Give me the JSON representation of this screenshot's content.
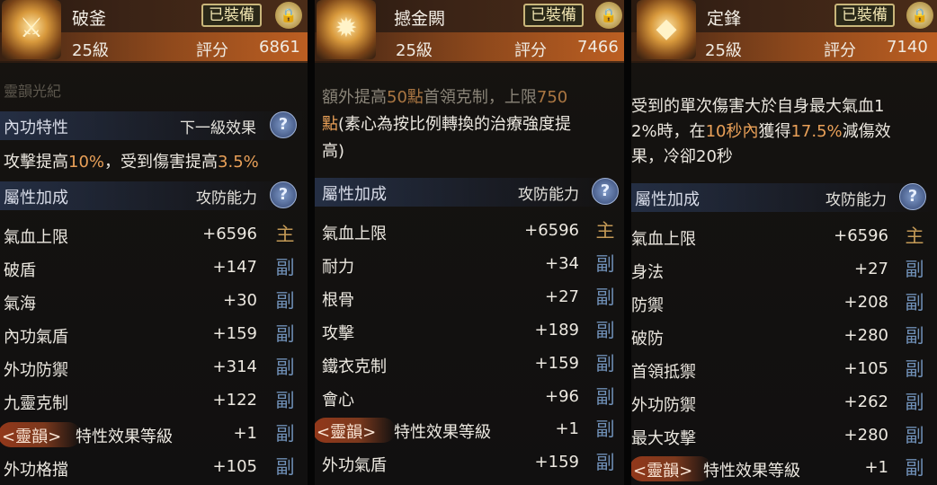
{
  "panels": [
    {
      "name": "破釜",
      "level": "25級",
      "equipped": "已裝備",
      "score_label": "評分",
      "score": "6861",
      "top_faded": "靈韻光紀",
      "trait": {
        "title": "內功特性",
        "right": "下一級效果",
        "text_parts": [
          "攻擊提高",
          "10%",
          "，受到傷害提高",
          "3.5%"
        ]
      },
      "attr": {
        "title": "屬性加成",
        "right": "攻防能力"
      },
      "stats": [
        {
          "name": "氣血上限",
          "value": "+6596",
          "tag": "主",
          "kind": "main"
        },
        {
          "name": "破盾",
          "value": "+147",
          "tag": "副",
          "kind": "sub"
        },
        {
          "name": "氣海",
          "value": "+30",
          "tag": "副",
          "kind": "sub"
        },
        {
          "name": "內功氣盾",
          "value": "+159",
          "tag": "副",
          "kind": "sub"
        },
        {
          "name": "外功防禦",
          "value": "+314",
          "tag": "副",
          "kind": "sub"
        },
        {
          "name": "九靈克制",
          "value": "+122",
          "tag": "副",
          "kind": "sub"
        }
      ],
      "rune": {
        "label": "<靈韻>",
        "name": "特性效果等級",
        "value": "+1",
        "tag": "副"
      },
      "last": {
        "name": "外功格擋",
        "value": "+105",
        "tag": "副"
      }
    },
    {
      "name": "撼金闕",
      "level": "25級",
      "equipped": "已裝備",
      "score_label": "評分",
      "score": "7466",
      "trait_lines": [
        [
          "額外提高",
          "50點",
          "首領克制，上限",
          "750"
        ],
        [
          "點",
          "(素心為按比例轉換的治療強度提"
        ],
        [
          "高)"
        ]
      ],
      "attr": {
        "title": "屬性加成",
        "right": "攻防能力"
      },
      "stats": [
        {
          "name": "氣血上限",
          "value": "+6596",
          "tag": "主",
          "kind": "main"
        },
        {
          "name": "耐力",
          "value": "+34",
          "tag": "副",
          "kind": "sub"
        },
        {
          "name": "根骨",
          "value": "+27",
          "tag": "副",
          "kind": "sub"
        },
        {
          "name": "攻擊",
          "value": "+189",
          "tag": "副",
          "kind": "sub"
        },
        {
          "name": "鐵衣克制",
          "value": "+159",
          "tag": "副",
          "kind": "sub"
        },
        {
          "name": "會心",
          "value": "+96",
          "tag": "副",
          "kind": "sub"
        }
      ],
      "rune": {
        "label": "<靈韻>",
        "name": "特性效果等級",
        "value": "+1",
        "tag": "副"
      },
      "last": {
        "name": "外功氣盾",
        "value": "+159",
        "tag": "副"
      }
    },
    {
      "name": "定鋒",
      "level": "25級",
      "equipped": "已裝備",
      "score_label": "評分",
      "score": "7140",
      "trait_lines": [
        [
          "受到的單次傷害大於自身最大氣血1"
        ],
        [
          "2%時，在",
          "10秒內",
          "獲得",
          "17.5%",
          "減傷效"
        ],
        [
          "果，冷卻20秒"
        ]
      ],
      "attr": {
        "title": "屬性加成",
        "right": "攻防能力"
      },
      "stats": [
        {
          "name": "氣血上限",
          "value": "+6596",
          "tag": "主",
          "kind": "main"
        },
        {
          "name": "身法",
          "value": "+27",
          "tag": "副",
          "kind": "sub"
        },
        {
          "name": "防禦",
          "value": "+208",
          "tag": "副",
          "kind": "sub"
        },
        {
          "name": "破防",
          "value": "+280",
          "tag": "副",
          "kind": "sub"
        },
        {
          "name": "首領抵禦",
          "value": "+105",
          "tag": "副",
          "kind": "sub"
        },
        {
          "name": "外功防禦",
          "value": "+262",
          "tag": "副",
          "kind": "sub"
        },
        {
          "name": "最大攻擊",
          "value": "+280",
          "tag": "副",
          "kind": "sub"
        }
      ],
      "rune": {
        "label": "<靈韻>",
        "name": "特性效果等級",
        "value": "+1",
        "tag": "副"
      }
    }
  ],
  "icons": {
    "lock": "lock-icon",
    "help": "help-icon"
  }
}
